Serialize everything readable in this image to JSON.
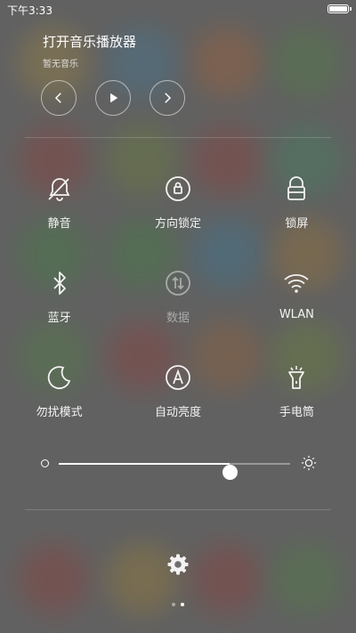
{
  "status_bar": {
    "time": "下午3:33"
  },
  "music": {
    "title": "打开音乐播放器",
    "subtitle": "暂无音乐"
  },
  "toggles": [
    {
      "label": "静音",
      "icon": "bell-off-icon"
    },
    {
      "label": "方向锁定",
      "icon": "rotation-lock-icon"
    },
    {
      "label": "锁屏",
      "icon": "lock-icon"
    },
    {
      "label": "蓝牙",
      "icon": "bluetooth-icon"
    },
    {
      "label": "数据",
      "icon": "mobile-data-icon"
    },
    {
      "label": "WLAN",
      "icon": "wifi-icon"
    },
    {
      "label": "勿扰模式",
      "icon": "moon-icon"
    },
    {
      "label": "自动亮度",
      "icon": "auto-brightness-icon"
    },
    {
      "label": "手电筒",
      "icon": "flashlight-icon"
    }
  ],
  "brightness": {
    "level": 0.74
  },
  "pager": {
    "total": 2,
    "current": 2
  },
  "colors": {
    "icon": "#f2f2f2",
    "disabled": "#a9a9a9"
  }
}
